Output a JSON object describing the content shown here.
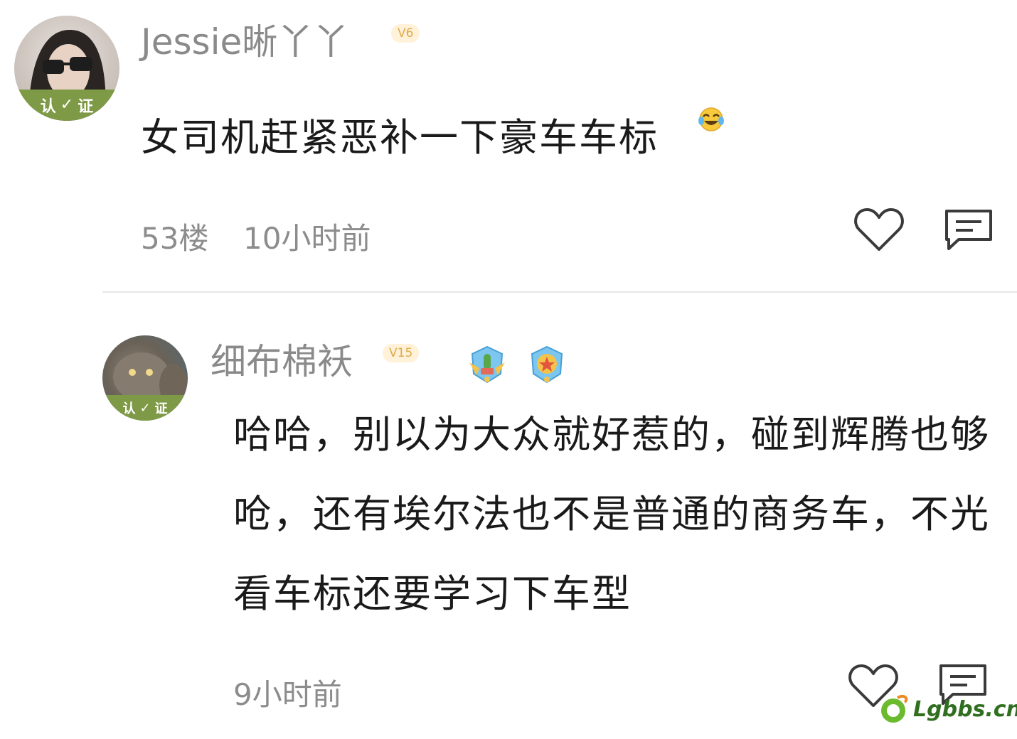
{
  "comments": [
    {
      "username": "Jessie晰丫丫",
      "level": "V6",
      "text": "女司机赶紧恶补一下豪车车标",
      "emoji": "laughing-tears-icon",
      "floor": "53楼",
      "time": "10小时前",
      "verify_left": "认",
      "verify_mark": "✓",
      "verify_right": "证"
    },
    {
      "username": "细布棉袄",
      "level": "V15",
      "text": "哈哈，别以为大众就好惹的，碰到辉腾也够呛，还有埃尔法也不是普通的商务车，不光看车标还要学习下车型",
      "time": "9小时前",
      "verify_left": "认",
      "verify_mark": "✓",
      "verify_right": "证"
    }
  ],
  "watermark": {
    "text": "Lgbbs.cn"
  },
  "colors": {
    "username": "#8a8a8a",
    "level_badge": "#e0a94a",
    "verify_band": "#7f9a46",
    "meta": "#8c8c8c"
  }
}
